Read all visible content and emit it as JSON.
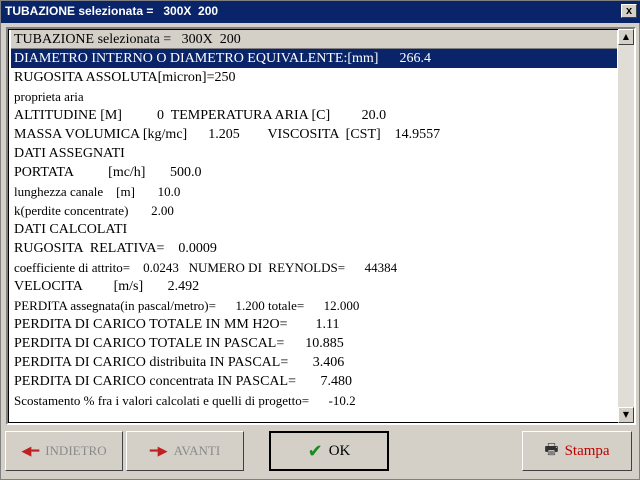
{
  "window": {
    "title": "TUBAZIONE selezionata =   300X  200",
    "close_glyph": "x"
  },
  "list": {
    "header": "TUBAZIONE selezionata =   300X  200",
    "rows": [
      {
        "text": "DIAMETRO INTERNO O DIAMETRO EQUIVALENTE:[mm]      266.4",
        "selected": true
      },
      {
        "text": "RUGOSITA ASSOLUTA[micron]=250"
      },
      {
        "text": "proprieta aria",
        "small": true
      },
      {
        "text": "ALTITUDINE [M]          0  TEMPERATURA ARIA [C]         20.0"
      },
      {
        "text": "MASSA VOLUMICA [kg/mc]      1.205        VISCOSITA  [CST]    14.9557"
      },
      {
        "text": "DATI ASSEGNATI"
      },
      {
        "text": "PORTATA          [mc/h]       500.0"
      },
      {
        "text": "lunghezza canale    [m]       10.0",
        "small": true
      },
      {
        "text": "k(perdite concentrate)       2.00",
        "small": true
      },
      {
        "text": "DATI CALCOLATI"
      },
      {
        "text": "RUGOSITA  RELATIVA=    0.0009"
      },
      {
        "text": "coefficiente di attrito=    0.0243   NUMERO DI  REYNOLDS=      44384",
        "small": true
      },
      {
        "text": "VELOCITA         [m/s]       2.492"
      },
      {
        "text": "PERDITA assegnata(in pascal/metro)=      1.200 totale=      12.000",
        "small": true
      },
      {
        "text": "PERDITA DI CARICO TOTALE IN MM H2O=        1.11"
      },
      {
        "text": "PERDITA DI CARICO TOTALE IN PASCAL=      10.885"
      },
      {
        "text": "PERDITA DI CARICO distribuita IN PASCAL=       3.406"
      },
      {
        "text": "PERDITA DI CARICO concentrata IN PASCAL=       7.480"
      },
      {
        "text": "Scostamento % fra i valori calcolati e quelli di progetto=      -10.2",
        "small": true
      }
    ],
    "scroll_up": "▲",
    "scroll_down": "▼"
  },
  "buttons": {
    "back": {
      "label": "INDIETRO",
      "icon": "arrow-left-icon",
      "glyph": "◀━"
    },
    "forward": {
      "label": "AVANTI",
      "icon": "arrow-right-icon",
      "glyph": "━▶"
    },
    "ok": {
      "label": "OK",
      "icon": "checkmark-icon",
      "glyph": "✔"
    },
    "print": {
      "label": "Stampa",
      "icon": "printer-icon",
      "glyph": "🖶"
    }
  },
  "colors": {
    "selection": "#0a246a",
    "titlebar": "#0a246a",
    "face": "#d4d0c8",
    "accent_red": "#c00000",
    "check_green": "#1a8a1a"
  }
}
